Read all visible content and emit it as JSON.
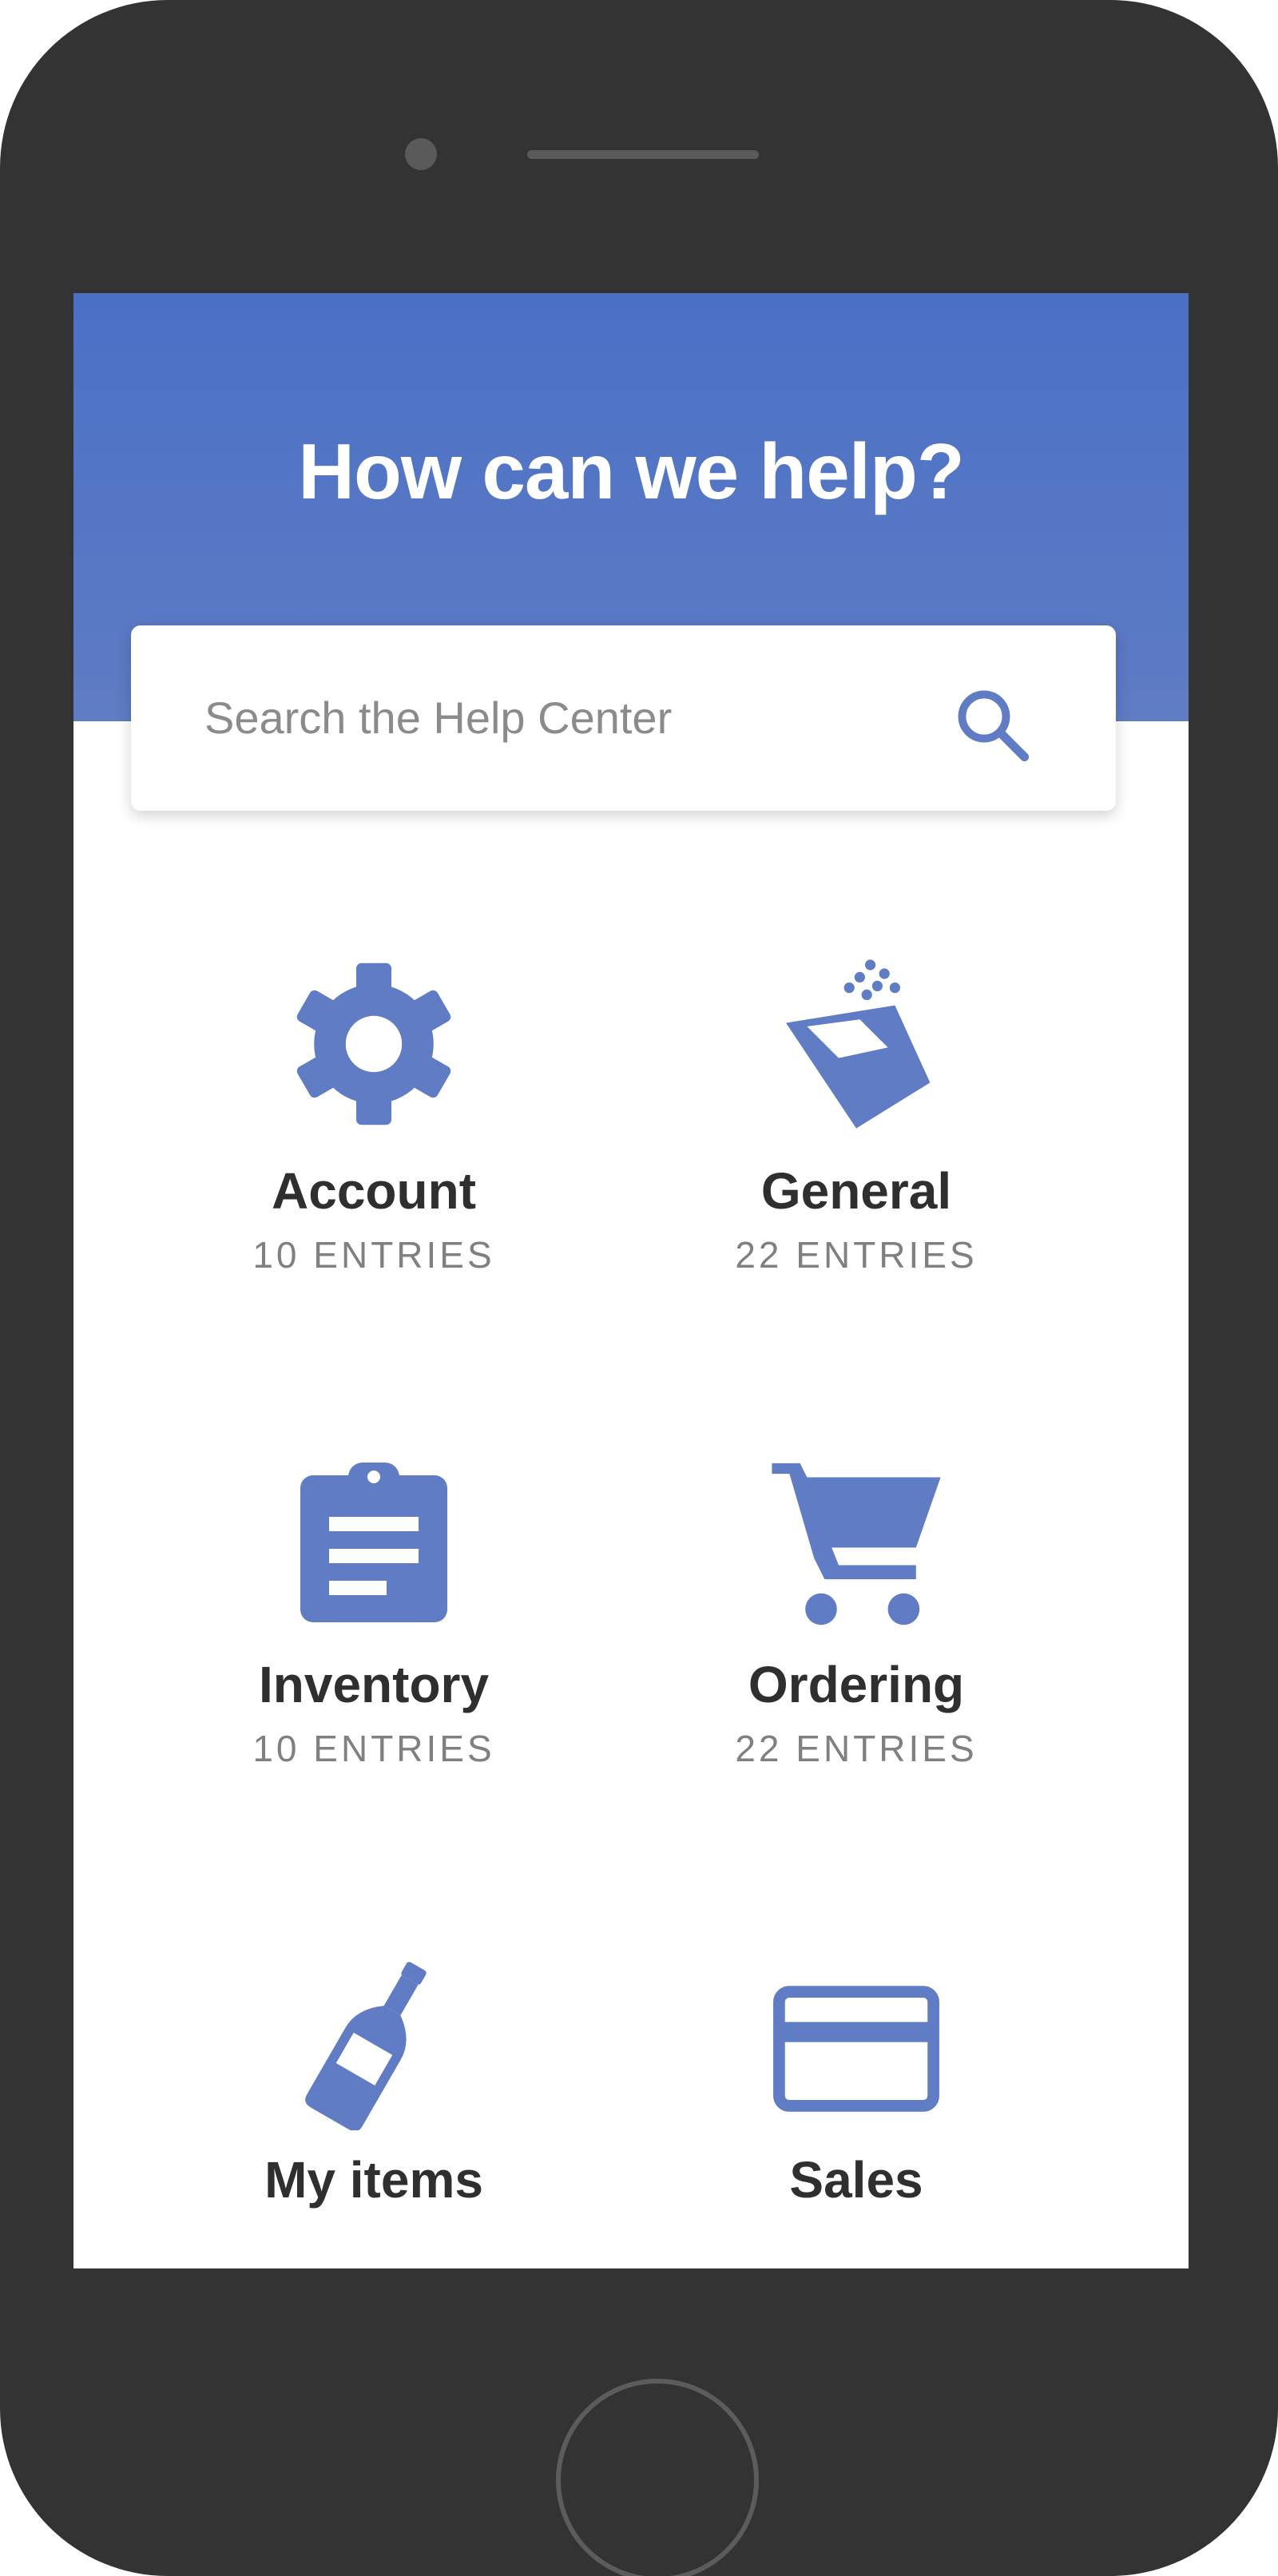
{
  "header": {
    "title": "How can we help?"
  },
  "search": {
    "placeholder": "Search the Help Center",
    "icon": "search-icon"
  },
  "categories": [
    {
      "name": "Account",
      "count": "10 ENTRIES",
      "icon": "gear-icon"
    },
    {
      "name": "General",
      "count": "22 ENTRIES",
      "icon": "popcorn-icon"
    },
    {
      "name": "Inventory",
      "count": "10 ENTRIES",
      "icon": "clipboard-icon"
    },
    {
      "name": "Ordering",
      "count": "22 ENTRIES",
      "icon": "cart-icon"
    },
    {
      "name": "My items",
      "icon": "bottle-icon"
    },
    {
      "name": "Sales",
      "icon": "credit-card-icon"
    }
  ],
  "colors": {
    "accent": "#5f7cc4",
    "header_bg": "#4a70c6",
    "device": "#333333",
    "text_dark": "#2f2f2f",
    "text_muted": "#808080"
  }
}
